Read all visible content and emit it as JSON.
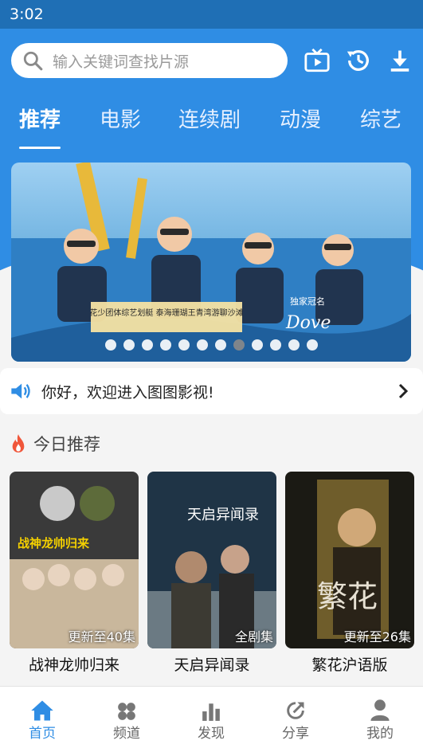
{
  "status_bar": {
    "time": "3:02"
  },
  "search": {
    "placeholder": "输入关键词查找片源"
  },
  "header_icons": [
    "tv-icon",
    "history-icon",
    "download-icon"
  ],
  "tabs": [
    {
      "label": "推荐",
      "active": true
    },
    {
      "label": "电影"
    },
    {
      "label": "连续剧"
    },
    {
      "label": "动漫"
    },
    {
      "label": "综艺"
    }
  ],
  "banner": {
    "overlay_text": "花少团体综艺划艇 泰海珊瑚王青湾游聊沙滩",
    "sponsor_label": "独家冠名",
    "sponsor_brand": "Dove",
    "dot_count": 12,
    "active_dot_index": 7
  },
  "notice": {
    "text": "你好，欢迎进入图图影视!"
  },
  "today_section": {
    "title": "今日推荐"
  },
  "recommendations": [
    {
      "title": "战神龙帅归来",
      "badge": "更新至40集",
      "poster_text": "战神龙帅归来",
      "colors": [
        "#3a3a3a",
        "#c9b79c"
      ]
    },
    {
      "title": "天启异闻录",
      "badge": "全剧集",
      "poster_text": "天启异闻录",
      "colors": [
        "#1f3446",
        "#6b7a83"
      ]
    },
    {
      "title": "繁花沪语版",
      "badge": "更新至26集",
      "poster_text": "繁花",
      "colors": [
        "#1b1a14",
        "#a88a3a"
      ]
    }
  ],
  "bottom_nav": [
    {
      "label": "首页",
      "icon": "home-icon",
      "active": true
    },
    {
      "label": "频道",
      "icon": "channel-icon"
    },
    {
      "label": "发现",
      "icon": "chart-icon"
    },
    {
      "label": "分享",
      "icon": "share-icon"
    },
    {
      "label": "我的",
      "icon": "user-icon"
    }
  ],
  "colors": {
    "primary": "#2f8de4",
    "status_bar": "#1f6fb5"
  }
}
